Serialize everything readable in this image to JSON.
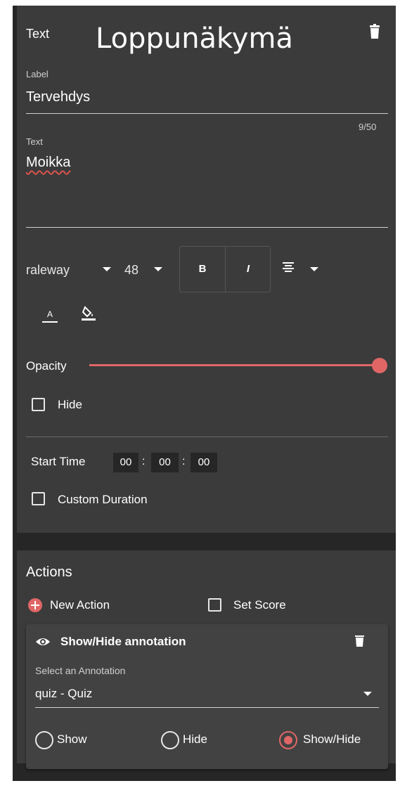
{
  "header": {
    "section": "Text",
    "title": "Loppunäkymä"
  },
  "label_field": {
    "label": "Label",
    "value": "Tervehdys"
  },
  "text_field": {
    "label": "Text",
    "counter": "9/50",
    "value": "Moikka"
  },
  "font_toolbar": {
    "font": "raleway",
    "size": "48",
    "bold": "B",
    "italic": "I"
  },
  "color_tools": {
    "font_color_letter": "A"
  },
  "opacity": {
    "label": "Opacity",
    "value_percent": 100
  },
  "hide": {
    "label": "Hide",
    "checked": false
  },
  "start_time": {
    "label": "Start Time",
    "hh": "00",
    "mm": "00",
    "ss": "00",
    "sep": ":"
  },
  "custom_duration": {
    "label": "Custom Duration",
    "checked": false
  },
  "actions": {
    "title": "Actions",
    "new_action": "New Action",
    "set_score": "Set Score",
    "card": {
      "title": "Show/Hide annotation",
      "select_label": "Select an Annotation",
      "select_value": "quiz - Quiz",
      "radios": [
        {
          "label": "Show",
          "selected": false
        },
        {
          "label": "Hide",
          "selected": false
        },
        {
          "label": "Show/Hide",
          "selected": true
        }
      ]
    }
  },
  "colors": {
    "accent": "#e06666",
    "panel": "#3b3b3b",
    "background": "#262626"
  }
}
